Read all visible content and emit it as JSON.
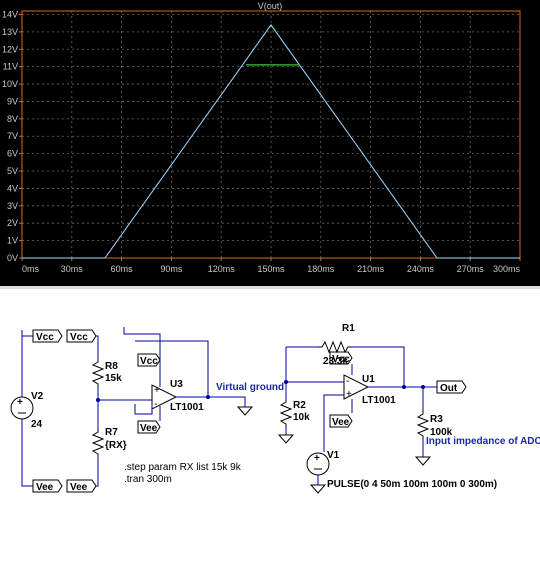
{
  "plot": {
    "trace_label": "V(out)",
    "trace_color": "#9edcff",
    "title_color": "#3fc83f",
    "cursor_color": "#3fc83f",
    "frame_color": "#d26b25"
  },
  "chart_data": {
    "type": "line",
    "title": "V(out)",
    "x_ticks": [
      "0ms",
      "30ms",
      "60ms",
      "90ms",
      "120ms",
      "150ms",
      "180ms",
      "210ms",
      "240ms",
      "270ms",
      "300ms"
    ],
    "y_ticks": [
      "0V",
      "1V",
      "2V",
      "3V",
      "4V",
      "5V",
      "6V",
      "7V",
      "8V",
      "9V",
      "10V",
      "11V",
      "12V",
      "13V",
      "14V"
    ],
    "xlim": [
      0,
      300
    ],
    "ylim": [
      0,
      14.2
    ],
    "grid": true,
    "series": [
      {
        "x": [
          0,
          50,
          150,
          250,
          300
        ],
        "values": [
          0,
          0,
          13.4,
          0,
          0
        ]
      },
      {
        "x": [
          135,
          167
        ],
        "values": [
          11.1,
          11.1
        ]
      }
    ]
  },
  "schematic": {
    "v2": {
      "name": "V2",
      "value": "24"
    },
    "r8": {
      "name": "R8",
      "value": "15k"
    },
    "r7": {
      "name": "R7",
      "value": "{RX}"
    },
    "u3": {
      "name": "U3",
      "part": "LT1001"
    },
    "r1": {
      "name": "R1",
      "value": "23.3k"
    },
    "r2": {
      "name": "R2",
      "value": "10k"
    },
    "u1": {
      "name": "U1",
      "part": "LT1001"
    },
    "r3": {
      "name": "R3",
      "value": "100k"
    },
    "v1": {
      "name": "V1",
      "value": "PULSE(0 4 50m 100m 100m 0 300m)"
    },
    "labels": {
      "vcc_top_left": "Vcc",
      "vcc_top_mid": "Vcc",
      "vcc_u3": "Vcc",
      "vee_u3": "Vee",
      "vee_bot_left": "Vee",
      "vee_bot_mid": "Vee",
      "vcc_u1": "Vcc",
      "vee_u1": "Vee",
      "out": "Out"
    },
    "annotations": {
      "virtual_ground": "Virtual ground",
      "input_impedance": "Input impedance of ADC"
    },
    "directives": {
      "step": ".step param RX list 15k 9k",
      "tran": ".tran 300m"
    }
  }
}
